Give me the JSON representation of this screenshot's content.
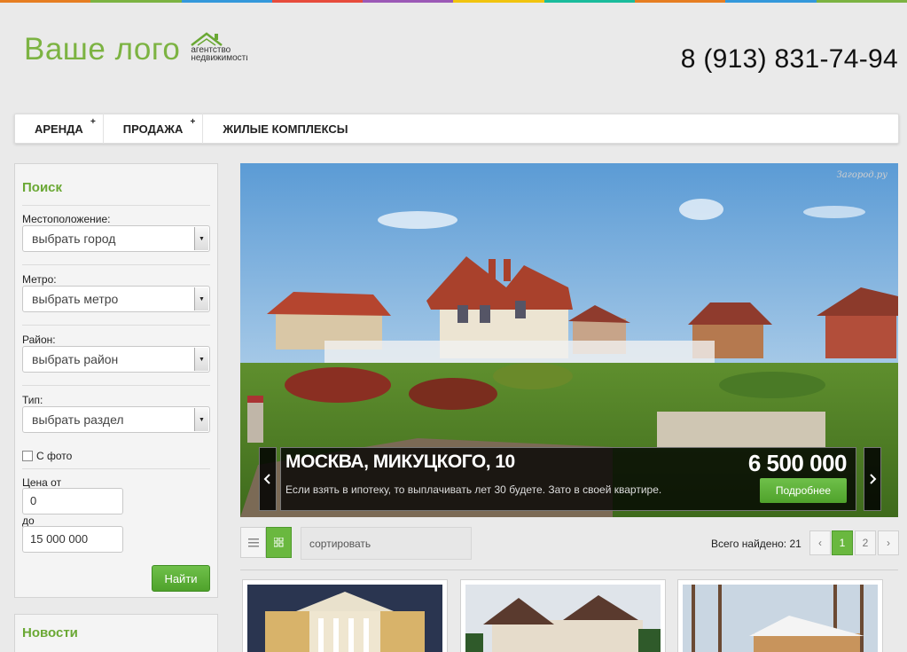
{
  "header": {
    "logo_text": "Ваше лого",
    "logo_sub_1": "агентство",
    "logo_sub_2": "недвижимости",
    "phone": "8 (913) 831-74-94"
  },
  "colors": {
    "accent": "#6aa834",
    "button_green": "#5bb035",
    "stripe": [
      "#e67e22",
      "#7cb342",
      "#3498db",
      "#e74c3c",
      "#9b59b6",
      "#f1c40f",
      "#1abc9c",
      "#e67e22",
      "#3498db",
      "#7cb342"
    ]
  },
  "nav": {
    "items": [
      {
        "label": "АРЕНДА",
        "has_submenu": true,
        "marker": "+"
      },
      {
        "label": "ПРОДАЖА",
        "has_submenu": true,
        "marker": "+"
      },
      {
        "label": "ЖИЛЫЕ КОМПЛЕКСЫ",
        "has_submenu": false
      }
    ]
  },
  "search": {
    "title": "Поиск",
    "location_label": "Местоположение:",
    "location_value": "выбрать город",
    "metro_label": "Метро:",
    "metro_value": "выбрать метро",
    "district_label": "Район:",
    "district_value": "выбрать район",
    "type_label": "Тип:",
    "type_value": "выбрать раздел",
    "photo_label": "С фото",
    "photo_checked": false,
    "price_from_label": "Цена от",
    "price_from_value": "0",
    "price_to_label": "до",
    "price_to_value": "15 000 000",
    "submit_label": "Найти"
  },
  "news": {
    "title": "Новости"
  },
  "slider": {
    "watermark": "Загород.ру",
    "address": "МОСКВА, МИКУЦКОГО, 10",
    "description": "Если взять в ипотеку, то выплачивать лет 30 будете. Зато в своей квартире.",
    "price": "6 500 000",
    "more_label": "Подробнее",
    "prev_icon": "chevron-left-icon",
    "next_icon": "chevron-right-icon"
  },
  "listing": {
    "sort_label": "сортировать",
    "total_label": "Всего найдено: 21",
    "pages": [
      "1",
      "2"
    ],
    "current_page": "1",
    "prev_page": "‹",
    "next_page": "›",
    "view_modes": [
      "list-view-icon",
      "grid-view-icon"
    ],
    "active_view": "grid"
  }
}
